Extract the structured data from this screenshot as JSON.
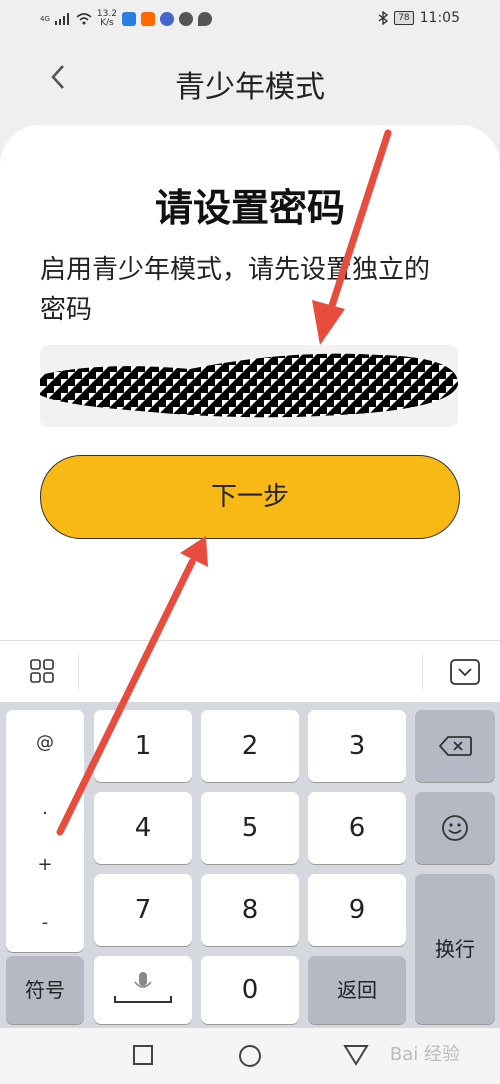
{
  "status_bar": {
    "network": "4G",
    "speed_value": "13.2",
    "speed_unit": "K/s",
    "battery": "78",
    "time": "11:05"
  },
  "header": {
    "back_icon": "chevron-left-icon",
    "title": "青少年模式"
  },
  "card": {
    "heading": "请设置密码",
    "description": "启用青少年模式，请先设置独立的密码",
    "password_value": "",
    "next_label": "下一步"
  },
  "keyboard": {
    "toolbar_left_icon": "grid-icon",
    "toolbar_right_icon": "keyboard-hide-icon",
    "symbols": [
      "@",
      ".",
      "+",
      "-"
    ],
    "digits_row1": [
      "1",
      "2",
      "3"
    ],
    "digits_row2": [
      "4",
      "5",
      "6"
    ],
    "digits_row3": [
      "7",
      "8",
      "9"
    ],
    "symbol_key": "符号",
    "zero": "0",
    "return_key": "返回",
    "enter_key": "换行"
  },
  "watermark": "Bai 经验",
  "colors": {
    "accent": "#f9b915",
    "arrow": "#e84c3d"
  }
}
